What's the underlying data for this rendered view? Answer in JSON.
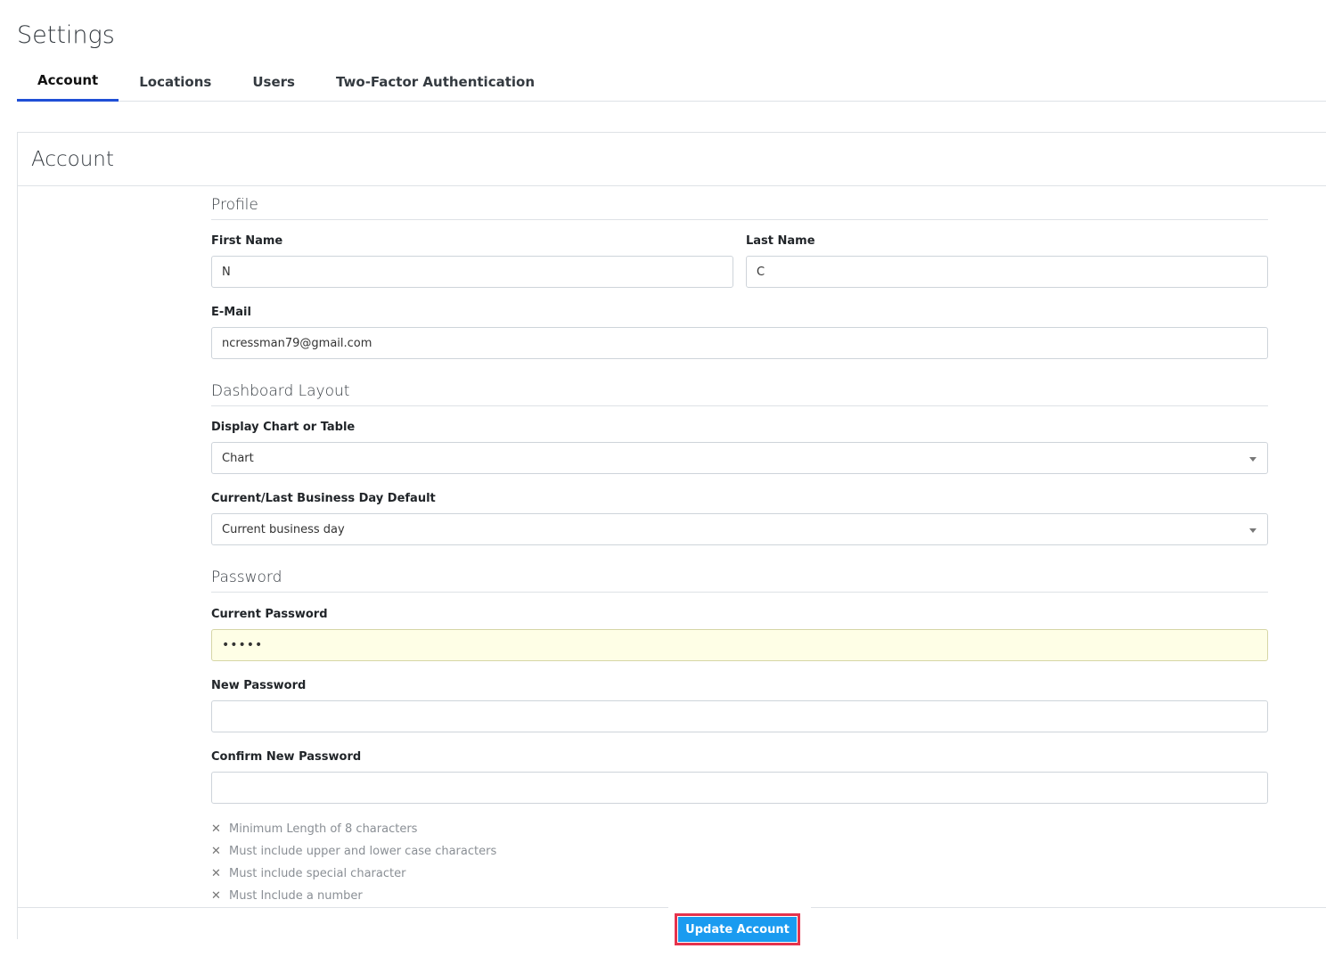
{
  "page": {
    "title": "Settings"
  },
  "tabs": [
    {
      "label": "Account",
      "active": true
    },
    {
      "label": "Locations",
      "active": false
    },
    {
      "label": "Users",
      "active": false
    },
    {
      "label": "Two-Factor Authentication",
      "active": false
    }
  ],
  "card": {
    "title": "Account"
  },
  "profile": {
    "heading": "Profile",
    "first_name": {
      "label": "First Name",
      "value": "N"
    },
    "last_name": {
      "label": "Last Name",
      "value": "C"
    },
    "email": {
      "label": "E-Mail",
      "value": "ncressman79@gmail.com"
    }
  },
  "dashboard": {
    "heading": "Dashboard Layout",
    "display": {
      "label": "Display Chart or Table",
      "value": "Chart"
    },
    "business_day": {
      "label": "Current/Last Business Day Default",
      "value": "Current business day"
    }
  },
  "password": {
    "heading": "Password",
    "current": {
      "label": "Current Password",
      "value": "•••••"
    },
    "new": {
      "label": "New Password",
      "value": ""
    },
    "confirm": {
      "label": "Confirm New Password",
      "value": ""
    },
    "rules": [
      "Minimum Length of 8 characters",
      "Must include upper and lower case characters",
      "Must include special character",
      "Must Include a number"
    ],
    "rule_mark": "✕"
  },
  "actions": {
    "update_label": "Update Account"
  },
  "colors": {
    "accent": "#1f4fd6",
    "button": "#1a9bf0",
    "highlight": "#e5334d",
    "autofill": "#fefee6"
  }
}
